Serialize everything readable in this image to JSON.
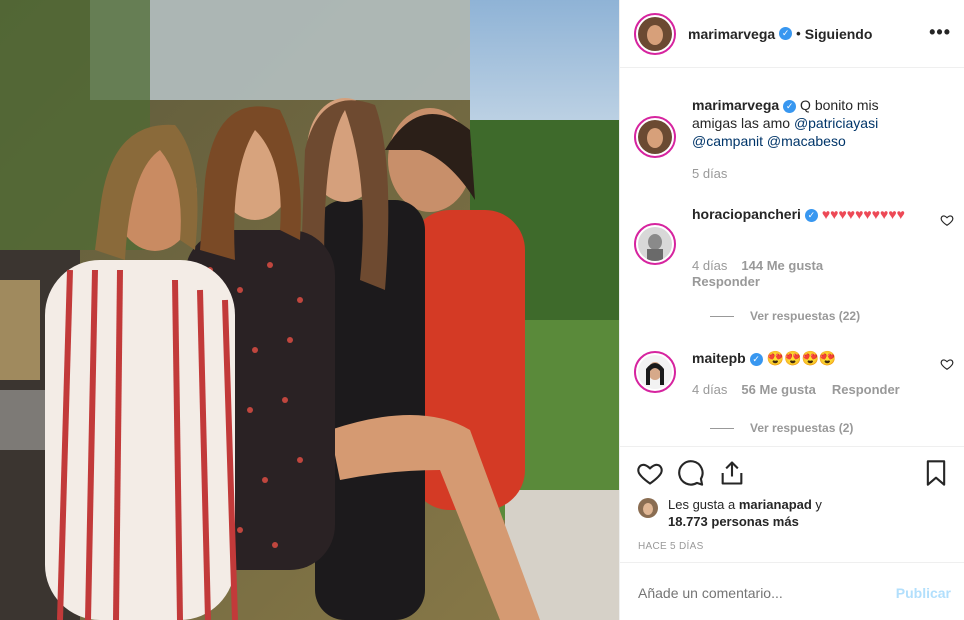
{
  "header": {
    "username": "marimarvega",
    "separator": "•",
    "follow_status": "Siguiendo",
    "more": "•••"
  },
  "caption": {
    "username": "marimarvega",
    "text_before": " Q bonito mis amigas las amo ",
    "mention1": "@patriciayasi",
    "mention2": "@campanit",
    "mention3": "@macabeso",
    "time": "5 días"
  },
  "comments": [
    {
      "username": "horaciopancheri",
      "text": "♥♥♥♥♥♥♥♥♥♥",
      "time": "4 días",
      "likes": "144 Me gusta",
      "reply": "Responder",
      "view_replies": "Ver respuestas (22)"
    },
    {
      "username": "maitepb",
      "text": "😍😍😍😍",
      "time": "4 días",
      "likes": "56 Me gusta",
      "reply": "Responder",
      "view_replies": "Ver respuestas (2)"
    }
  ],
  "likes": {
    "prefix": "Les gusta a ",
    "user": "marianapad",
    "middle": " y ",
    "count": "18.773 personas más"
  },
  "posted": "HACE 5 DÍAS",
  "add_comment": {
    "placeholder": "Añade un comentario...",
    "publish": "Publicar"
  },
  "icons": {
    "like": "heart-icon",
    "comment": "comment-icon",
    "share": "share-icon",
    "save": "bookmark-icon"
  },
  "colors": {
    "verified": "#3897f0",
    "heart": "#ed4956",
    "mention": "#003569",
    "publish_disabled": "#b2dffc"
  }
}
